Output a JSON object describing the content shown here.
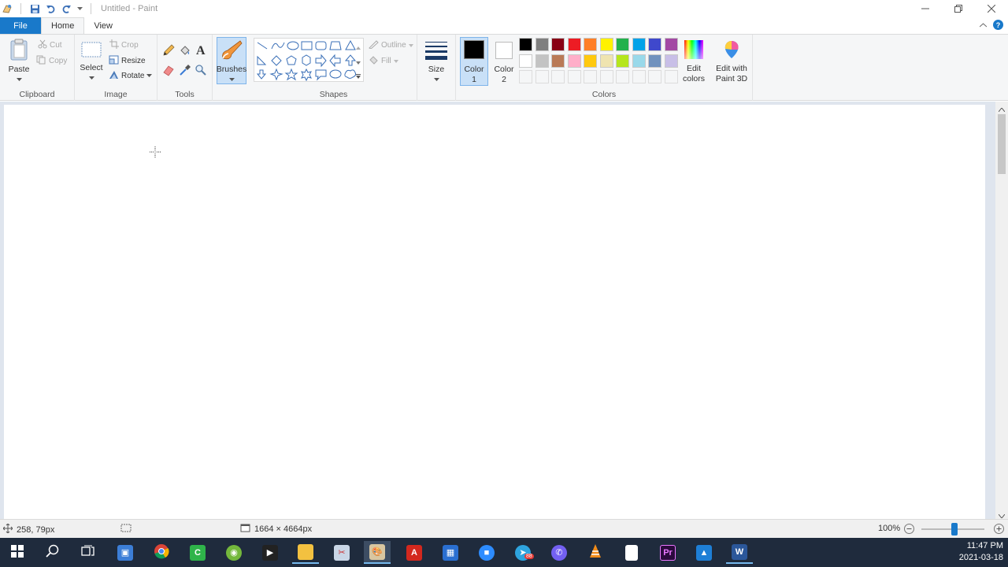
{
  "window": {
    "title": "Untitled - Paint"
  },
  "tabs": {
    "file": "File",
    "home": "Home",
    "view": "View"
  },
  "clipboard": {
    "paste": "Paste",
    "cut": "Cut",
    "copy": "Copy",
    "label": "Clipboard"
  },
  "image": {
    "select": "Select",
    "crop": "Crop",
    "resize": "Resize",
    "rotate": "Rotate",
    "label": "Image"
  },
  "tools": {
    "label": "Tools"
  },
  "brushes": {
    "label": "Brushes"
  },
  "shapes": {
    "outline": "Outline",
    "fill": "Fill",
    "label": "Shapes"
  },
  "size": {
    "label": "Size"
  },
  "colors": {
    "color1_label": "Color",
    "color1_num": "1",
    "color2_label": "Color",
    "color2_num": "2",
    "edit_colors_1": "Edit",
    "edit_colors_2": "colors",
    "paint3d_1": "Edit with",
    "paint3d_2": "Paint 3D",
    "label": "Colors",
    "color1": "#000000",
    "color2": "#ffffff",
    "palette_row1": [
      "#000000",
      "#7f7f7f",
      "#880015",
      "#ed1c24",
      "#ff7f27",
      "#fff200",
      "#22b14c",
      "#00a2e8",
      "#3f48cc",
      "#a349a4"
    ],
    "palette_row2": [
      "#ffffff",
      "#c3c3c3",
      "#b97a57",
      "#ffaec9",
      "#ffc90e",
      "#efe4b0",
      "#b5e61d",
      "#99d9ea",
      "#7092be",
      "#c8bfe7"
    ]
  },
  "status": {
    "cursor_pos": "258, 79px",
    "canvas_size": "1664 × 4664px",
    "zoom": "100%"
  },
  "clock": {
    "time": "11:47 PM",
    "date": "2021-03-18"
  },
  "taskbar": {
    "telegram_badge": "88"
  }
}
